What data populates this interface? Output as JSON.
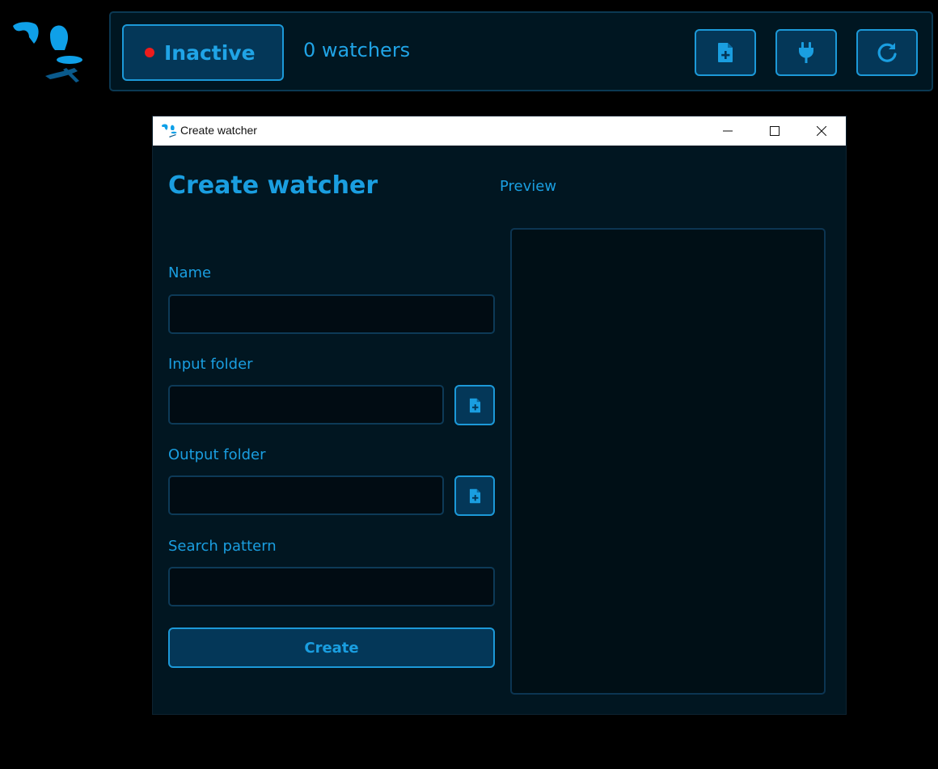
{
  "app": {
    "logo_icon": "app-logo-icon"
  },
  "toolbar": {
    "status_label": "Inactive",
    "status_color": "#ee1c1c",
    "watcher_count": "0 watchers",
    "buttons": [
      {
        "icon": "file-add-icon"
      },
      {
        "icon": "plug-icon"
      },
      {
        "icon": "refresh-icon"
      }
    ]
  },
  "dialog": {
    "window_title": "Create watcher",
    "heading": "Create watcher",
    "preview_label": "Preview",
    "fields": {
      "name": {
        "label": "Name",
        "value": "",
        "placeholder": ""
      },
      "input_folder": {
        "label": "Input folder",
        "value": "",
        "placeholder": ""
      },
      "output_folder": {
        "label": "Output folder",
        "value": "",
        "placeholder": ""
      },
      "search_pattern": {
        "label": "Search pattern",
        "value": "",
        "placeholder": ""
      }
    },
    "create_label": "Create"
  },
  "colors": {
    "accent": "#1a9ee0",
    "button_fill": "#043758",
    "background": "#011621"
  }
}
